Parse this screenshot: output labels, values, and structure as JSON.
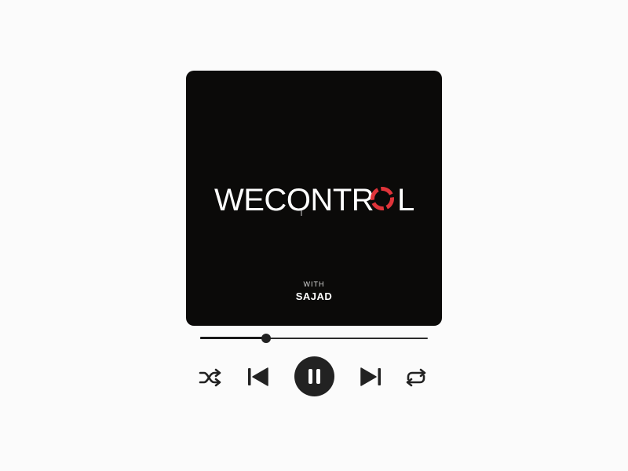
{
  "podcast": {
    "logo_text_left": "WECONTR",
    "logo_text_right": "L",
    "with_label": "WITH",
    "host": "SAJAD"
  },
  "playback": {
    "progress_fraction": 0.29,
    "state": "playing"
  },
  "controls": {
    "shuffle_icon": "shuffle-icon",
    "previous_icon": "skip-previous-icon",
    "pause_icon": "pause-icon",
    "next_icon": "skip-next-icon",
    "repeat_icon": "repeat-icon"
  },
  "colors": {
    "background": "#fbfbfb",
    "artwork": "#0b0a09",
    "logo_text": "#ffffff",
    "logo_accent": "#e0343a",
    "controls": "#222222"
  }
}
